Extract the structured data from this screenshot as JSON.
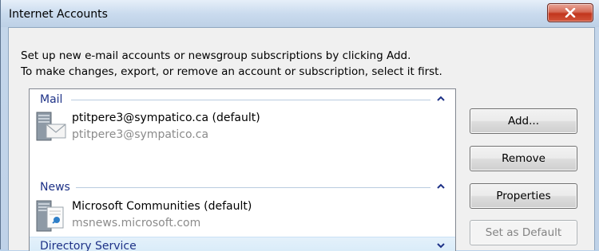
{
  "window": {
    "title": "Internet Accounts",
    "close_icon": "close-icon"
  },
  "instructions": {
    "line1": "Set up new e-mail accounts or newsgroup subscriptions by clicking Add.",
    "line2": "To make changes, export, or remove an account or subscription, select it first."
  },
  "groups": [
    {
      "label": "Mail",
      "state": "expanded",
      "accounts": [
        {
          "name": "ptitpere3@sympatico.ca (default)",
          "detail": "ptitpere3@sympatico.ca",
          "icon": "mail-server-icon"
        }
      ]
    },
    {
      "label": "News",
      "state": "expanded",
      "accounts": [
        {
          "name": "Microsoft Communities (default)",
          "detail": "msnews.microsoft.com",
          "icon": "news-server-icon"
        }
      ]
    },
    {
      "label": "Directory Service",
      "state": "collapsed",
      "selected": true,
      "accounts": []
    }
  ],
  "buttons": {
    "add": "Add...",
    "remove": "Remove",
    "properties": "Properties",
    "set_default": "Set as Default",
    "set_default_enabled": false
  },
  "colors": {
    "group_header_text": "#1e3287",
    "selection": "#d6eaf8",
    "secondary_text": "#8b8b8b"
  }
}
